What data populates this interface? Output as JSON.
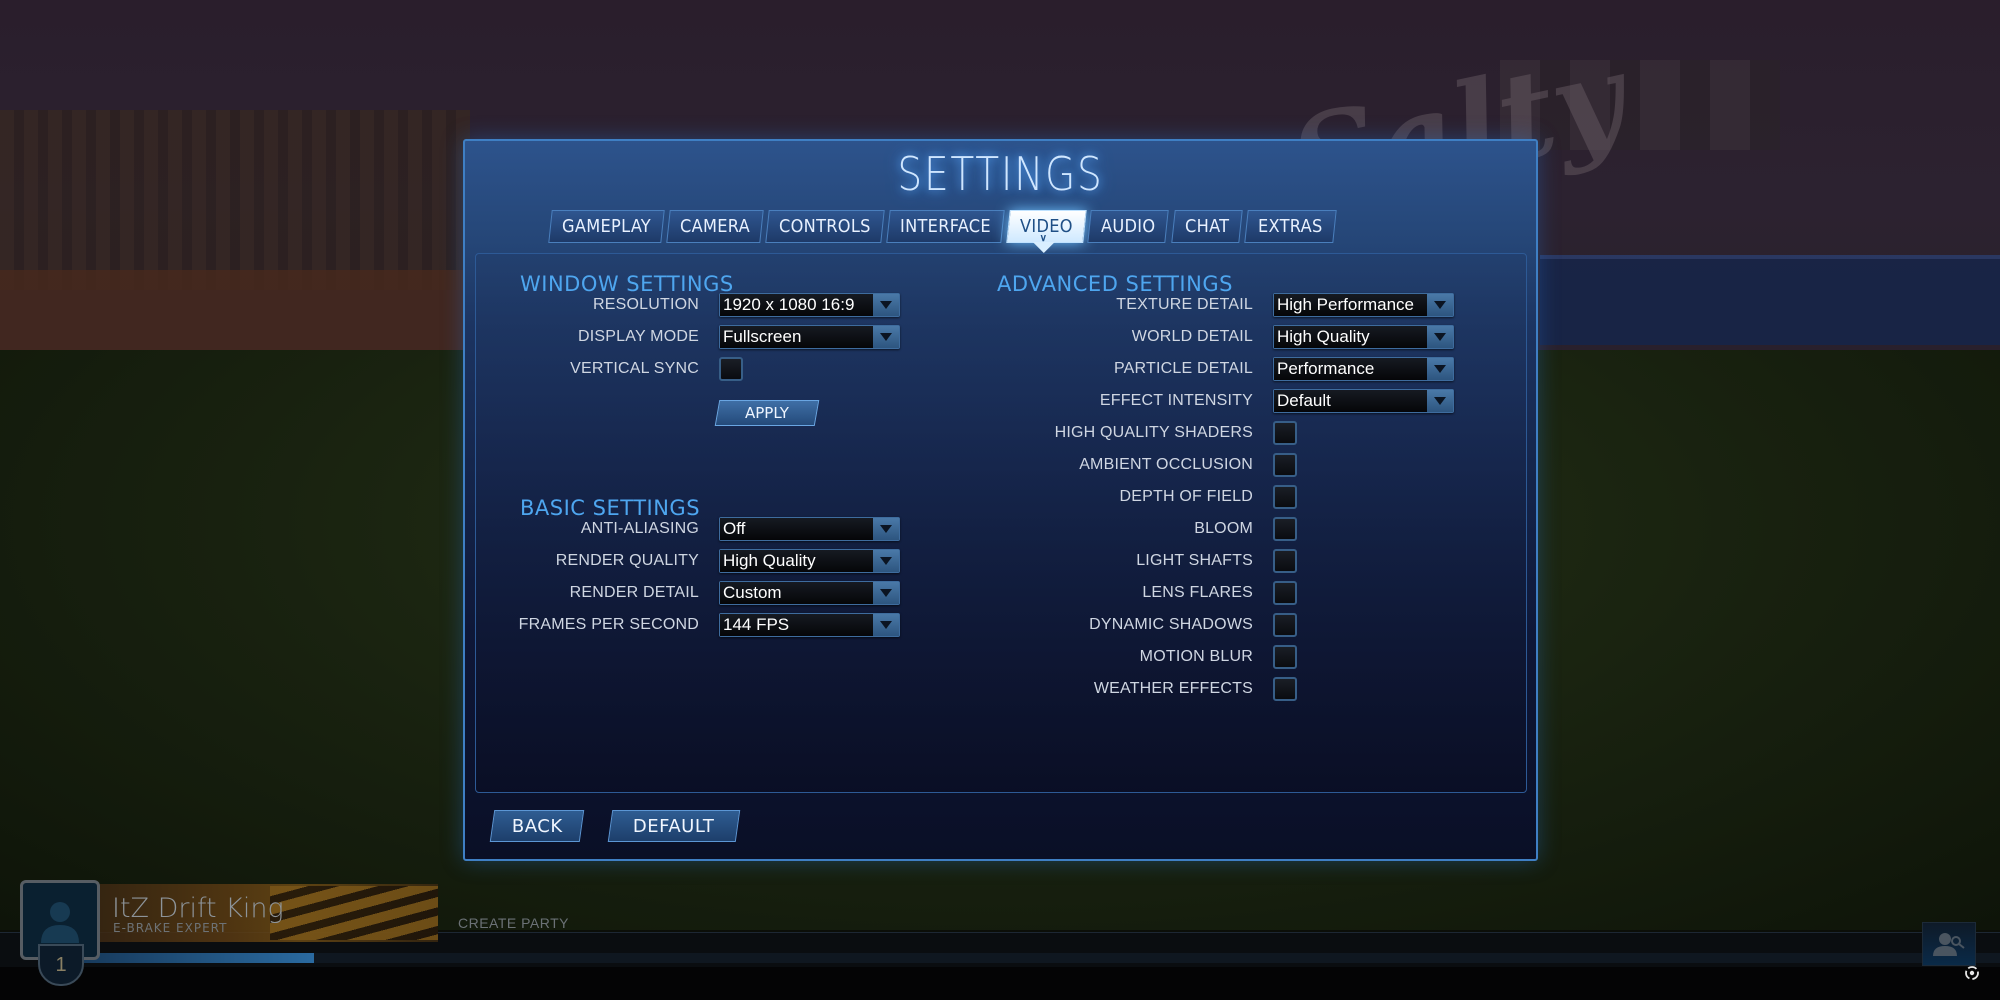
{
  "title": "SETTINGS",
  "tabs": [
    {
      "label": "GAMEPLAY",
      "active": false
    },
    {
      "label": "CAMERA",
      "active": false
    },
    {
      "label": "CONTROLS",
      "active": false
    },
    {
      "label": "INTERFACE",
      "active": false
    },
    {
      "label": "VIDEO",
      "active": true
    },
    {
      "label": "AUDIO",
      "active": false
    },
    {
      "label": "CHAT",
      "active": false
    },
    {
      "label": "EXTRAS",
      "active": false
    }
  ],
  "window_settings": {
    "heading": "WINDOW SETTINGS",
    "resolution": {
      "label": "RESOLUTION",
      "value": "1920 x 1080 16:9"
    },
    "display_mode": {
      "label": "DISPLAY MODE",
      "value": "Fullscreen"
    },
    "vertical_sync": {
      "label": "VERTICAL SYNC",
      "checked": false
    },
    "apply_label": "APPLY"
  },
  "basic_settings": {
    "heading": "BASIC SETTINGS",
    "anti_aliasing": {
      "label": "ANTI-ALIASING",
      "value": "Off"
    },
    "render_quality": {
      "label": "RENDER QUALITY",
      "value": "High Quality"
    },
    "render_detail": {
      "label": "RENDER DETAIL",
      "value": "Custom"
    },
    "fps": {
      "label": "FRAMES PER SECOND",
      "value": "144  FPS"
    }
  },
  "advanced_settings": {
    "heading": "ADVANCED SETTINGS",
    "texture_detail": {
      "label": "TEXTURE DETAIL",
      "value": "High Performance"
    },
    "world_detail": {
      "label": "WORLD DETAIL",
      "value": "High Quality"
    },
    "particle_detail": {
      "label": "PARTICLE DETAIL",
      "value": "Performance"
    },
    "effect_intensity": {
      "label": "EFFECT INTENSITY",
      "value": "Default"
    },
    "toggles": [
      {
        "label": "HIGH QUALITY SHADERS",
        "checked": false
      },
      {
        "label": "AMBIENT OCCLUSION",
        "checked": false
      },
      {
        "label": "DEPTH OF FIELD",
        "checked": false
      },
      {
        "label": "BLOOM",
        "checked": false
      },
      {
        "label": "LIGHT SHAFTS",
        "checked": false
      },
      {
        "label": "LENS FLARES",
        "checked": false
      },
      {
        "label": "DYNAMIC SHADOWS",
        "checked": false
      },
      {
        "label": "MOTION BLUR",
        "checked": false
      },
      {
        "label": "WEATHER EFFECTS",
        "checked": false
      }
    ]
  },
  "footer": {
    "back_label": "BACK",
    "default_label": "DEFAULT"
  },
  "player": {
    "name": "ItZ Drift King",
    "title": "E-BRAKE EXPERT",
    "level": "1",
    "xp_progress": 0.12,
    "create_party_label": "CREATE PARTY"
  },
  "colors": {
    "accent": "#4ea6ef",
    "panel_border": "#3f7fc4",
    "active_tab": "#cfe9ff"
  }
}
